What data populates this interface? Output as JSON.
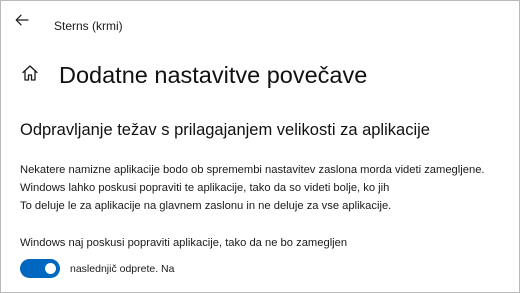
{
  "window": {
    "title": "Sterns (krmi)"
  },
  "page": {
    "title": "Dodatne nastavitve povečave"
  },
  "section": {
    "heading": "Odpravljanje težav s prilagajanjem velikosti za aplikacije",
    "description_lines": [
      "Nekatere namizne aplikacije bodo ob spremembi nastavitev zaslona morda videti zamegljene.",
      "Windows lahko poskusi popraviti te aplikacije, tako da so videti bolje, ko jih",
      "To deluje le za aplikacije na glavnem zaslonu in ne deluje za vse aplikacije."
    ]
  },
  "setting": {
    "label": "Windows naj poskusi popraviti aplikacije, tako da ne bo zamegljen",
    "toggle_state_text": "naslednjič odprete. Na",
    "toggle_on": true
  },
  "colors": {
    "accent": "#0067c0",
    "text": "#1a1a1a",
    "background": "#ffffff"
  },
  "icons": {
    "back": "back-arrow-icon",
    "home": "home-icon"
  }
}
